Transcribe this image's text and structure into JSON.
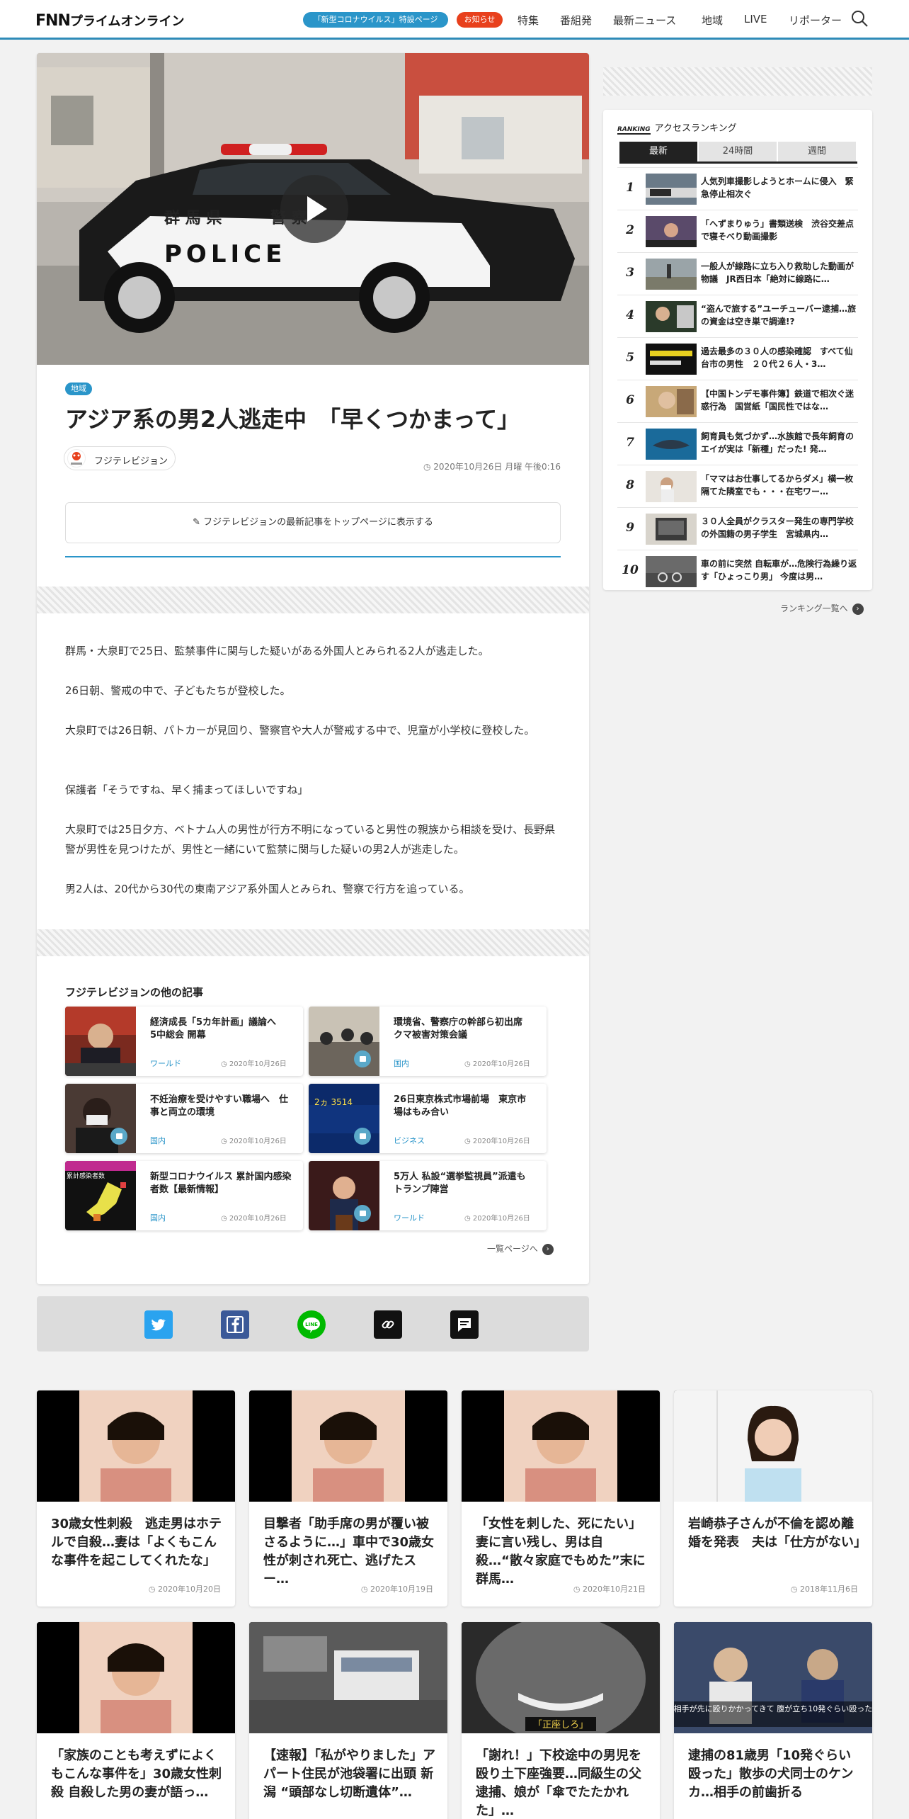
{
  "header": {
    "logo_main": "FNN",
    "logo_sub": "プライムオンライン",
    "corona_pill": "「新型コロナウイルス」特設ページ",
    "notice_pill": "お知らせ",
    "nav": [
      "特集",
      "番組発",
      "最新ニュース",
      "地域",
      "LIVE",
      "リポーター"
    ]
  },
  "article": {
    "tag": "地域",
    "title": "アジア系の男2人逃走中　「早くつかまって」",
    "source": "フジテレビジョン",
    "date": "2020年10月26日 月曜 午後0:16",
    "pin_text": "フジテレビジョンの最新記事をトップページに表示する",
    "paragraphs": [
      "群馬・大泉町で25日、監禁事件に関与した疑いがある外国人とみられる2人が逃走した。",
      "26日朝、警戒の中で、子どもたちが登校した。",
      "大泉町では26日朝、パトカーが見回り、警察官や大人が警戒する中で、児童が小学校に登校した。",
      "保護者「そうですね、早く捕まってほしいですね」",
      "大泉町では25日夕方、ベトナム人の男性が行方不明になっていると男性の親族から相談を受け、長野県警が男性を見つけたが、男性と一緒にいて監禁に関与した疑いの男2人が逃走した。",
      "男2人は、20代から30代の東南アジア系外国人とみられ、警察で行方を追っている。"
    ],
    "hero_text": {
      "prefecture": "群 馬 県",
      "police_jp": "警 察",
      "police_en": "POLICE"
    }
  },
  "related": {
    "heading": "フジテレビジョンの他の記事",
    "items": [
      {
        "title": "経済成長「5カ年計画」議論へ　5中総会 開幕",
        "category": "ワールド",
        "date": "2020年10月26日",
        "video": false
      },
      {
        "title": "環境省、警察庁の幹部ら初出席　クマ被害対策会議",
        "category": "国内",
        "date": "2020年10月26日",
        "video": true
      },
      {
        "title": "不妊治療を受けやすい職場へ　仕事と両立の環境",
        "category": "国内",
        "date": "2020年10月26日",
        "video": true
      },
      {
        "title": "26日東京株式市場前場　東京市場はもみ合い",
        "category": "ビジネス",
        "date": "2020年10月26日",
        "video": true
      },
      {
        "title": "新型コロナウイルス 累計国内感染者数【最新情報】",
        "category": "国内",
        "date": "2020年10月26日",
        "video": false
      },
      {
        "title": "5万人 私設“選挙監視員”派遣も　トランプ陣営",
        "category": "ワールド",
        "date": "2020年10月26日",
        "video": true
      }
    ],
    "more": "一覧ページへ",
    "thumb_texts": {
      "stocks": "2ヵ 3514",
      "covid": "累計感染者数"
    }
  },
  "share": {
    "buttons": [
      "twitter",
      "facebook",
      "LINE",
      "link",
      "comment"
    ]
  },
  "ranking": {
    "badge": "RANKING",
    "title": "アクセスランキング",
    "tabs": [
      "最新",
      "24時間",
      "週間"
    ],
    "items": [
      "人気列車撮影しようとホームに侵入　緊急停止相次ぐ",
      "「へずまりゅう」書類送検　渋谷交差点で寝そべり動画撮影",
      "一般人が線路に立ち入り救助した動画が物議　JR西日本「絶対に線路に…",
      "“盗んで旅する”ユーチューバー逮捕…旅の資金は空き巣で調達!?",
      "過去最多の３０人の感染確認　すべて仙台市の男性　２０代２６人・3…",
      "【中国トンデモ事件簿】鉄道で相次ぐ迷惑行為　国営紙「国民性ではな…",
      "飼育員も気づかず…水族館で長年飼育のエイが実は「新種」だった! 発…",
      "「ママはお仕事してるからダメ」横一枚隔てた隣室でも・・・在宅ワー…",
      "３０人全員がクラスター発生の専門学校の外国籍の男子学生　宮城県内…",
      "車の前に突然 自転車が…危険行為繰り返す「ひょっこり男」 今度は男…"
    ],
    "more": "ランキング一覧へ"
  },
  "bottom": {
    "cards": [
      {
        "title": "30歳女性刺殺　逃走男はホテルで自殺…妻は「よくもこんな事件を起こしてくれたな」",
        "date": "2020年10月20日"
      },
      {
        "title": "目撃者「助手席の男が覆い被さるように…」車中で30歳女性が刺され死亡、逃げたスー…",
        "date": "2020年10月19日"
      },
      {
        "title": "「女性を刺した、死にたい」妻に言い残し、男は自殺…“散々家庭でもめた”末に　群馬…",
        "date": "2020年10月21日"
      },
      {
        "title": "岩崎恭子さんが不倫を認め離婚を発表　夫は「仕方がない」",
        "date": "2018年11月6日"
      },
      {
        "title": "「家族のことも考えずによくもこんな事件を」30歳女性刺殺 自殺した男の妻が語っ…",
        "date": ""
      },
      {
        "title": "【速報】「私がやりました」アパート住民が池袋署に出頭 新潟 “頭部なし切断遺体”…",
        "date": ""
      },
      {
        "title": "「謝れ！」下校途中の男児を殴り土下座強要…同級生の父逮捕、娘が「傘でたたかれた」…",
        "date": ""
      },
      {
        "title": "逮捕の81歳男「10発ぐらい殴った」散歩の犬同士のケンカ…相手の前歯折る",
        "date": ""
      }
    ],
    "captions": {
      "c7": "「正座しろ」",
      "c8": "「相手が先に殴りかかってきて\n腹が立ち10発ぐらい殴った」"
    }
  }
}
